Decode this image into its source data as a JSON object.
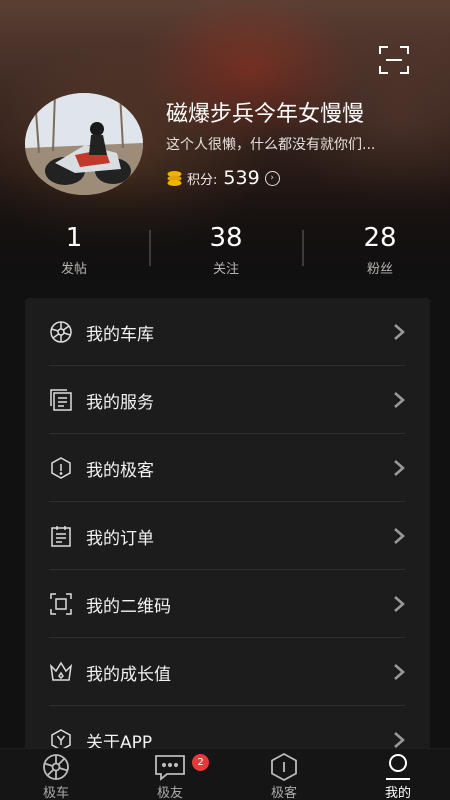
{
  "profile": {
    "username": "磁爆步兵今年女慢慢",
    "bio": "这个人很懒，什么都没有就你们...",
    "points_label": "积分:",
    "points_value": "539"
  },
  "stats": [
    {
      "value": "1",
      "label": "发帖"
    },
    {
      "value": "38",
      "label": "关注"
    },
    {
      "value": "28",
      "label": "粉丝"
    }
  ],
  "menu": [
    {
      "label": "我的车库",
      "icon": "wheel-icon"
    },
    {
      "label": "我的服务",
      "icon": "service-list-icon"
    },
    {
      "label": "我的极客",
      "icon": "hexagon-info-icon"
    },
    {
      "label": "我的订单",
      "icon": "order-calendar-icon"
    },
    {
      "label": "我的二维码",
      "icon": "qr-frame-icon"
    },
    {
      "label": "我的成长值",
      "icon": "crown-icon"
    },
    {
      "label": "关于APP",
      "icon": "hexagon-y-icon"
    }
  ],
  "tabs": [
    {
      "label": "极车",
      "icon": "wheel-icon",
      "active": false
    },
    {
      "label": "极友",
      "icon": "chat-bubble-icon",
      "active": false,
      "badge": "2"
    },
    {
      "label": "极客",
      "icon": "hexagon-icon",
      "active": false
    },
    {
      "label": "我的",
      "icon": "profile-arc-icon",
      "active": true
    }
  ],
  "colors": {
    "background": "#111111",
    "card": "#1c1c1c",
    "badge": "#e5393a",
    "coin": "#f0b400"
  }
}
